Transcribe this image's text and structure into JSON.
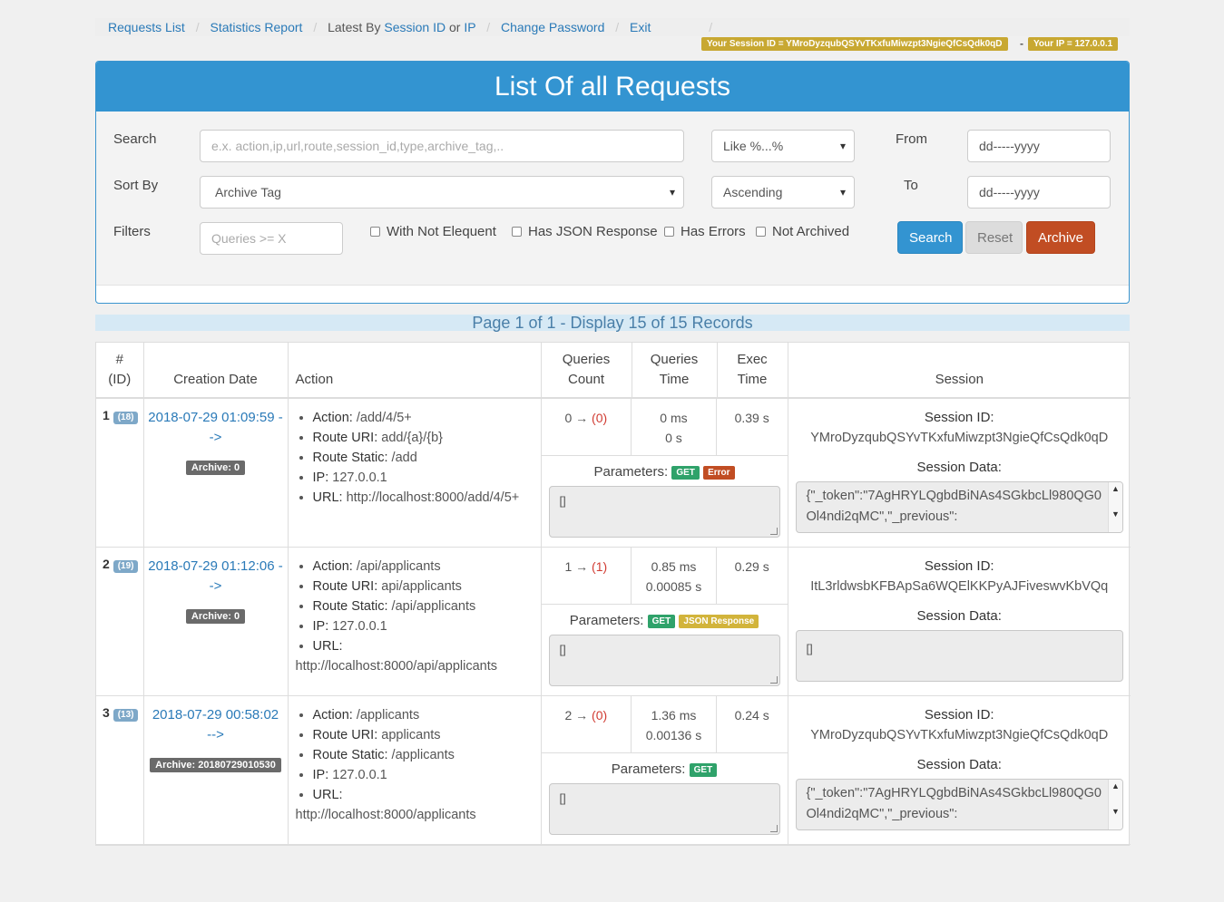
{
  "breadcrumb": {
    "requests_list": "Requests List",
    "statistics_report": "Statistics Report",
    "latest_by": "Latest By",
    "session_id": "Session ID",
    "or": "or",
    "ip": "IP",
    "change_password": "Change Password",
    "exit": "Exit",
    "separator": "/"
  },
  "session_bar": {
    "session_label": "Your Session ID = YMroDyzqubQSYvTKxfuMiwzpt3NgieQfCsQdk0qD",
    "dash": "-",
    "ip_label": "Your IP = 127.0.0.1"
  },
  "panel": {
    "title": "List Of all Requests",
    "search_label": "Search",
    "search_placeholder": "e.x. action,ip,url,route,session_id,type,archive_tag,..",
    "match_mode": "Like %...%",
    "from_label": "From",
    "from_value": "dd-----yyyy",
    "sort_label": "Sort By",
    "sort_value": "Archive Tag",
    "order_value": "Ascending",
    "to_label": "To",
    "to_value": "dd-----yyyy",
    "filters_label": "Filters",
    "queries_placeholder": "Queries >= X",
    "checkboxes": [
      "With Not Elequent",
      "Has JSON Response",
      "Has Errors",
      "Not Archived"
    ],
    "btn_search": "Search",
    "btn_reset": "Reset",
    "btn_archive": "Archive"
  },
  "page_info": "Page 1 of 1 - Display 15 of 15 Records",
  "table": {
    "headers": {
      "id_hash": "#",
      "id": "(ID)",
      "creation_date": "Creation Date",
      "action": "Action",
      "queries_count_1": "Queries",
      "queries_count_2": "Count",
      "queries_time_1": "Queries",
      "queries_time_2": "Time",
      "exec_time_1": "Exec",
      "exec_time_2": "Time",
      "session": "Session"
    },
    "labels": {
      "action": "Action:",
      "route_uri": "Route URI:",
      "route_static": "Route Static:",
      "ip": "IP:",
      "url": "URL:",
      "parameters": "Parameters:",
      "session_id": "Session ID:",
      "session_data": "Session Data:",
      "arrow": "→"
    },
    "rows": [
      {
        "num": "1",
        "id": "(18)",
        "date": "2018-07-29 01:09:59 -",
        "date2": "->",
        "archive": "Archive: 0",
        "action": "/add/4/5+",
        "route_uri": "add/{a}/{b}",
        "route_static": "/add",
        "ip": "127.0.0.1",
        "url": "http://localhost:8000/add/4/5+",
        "q_count": "0",
        "q_count_b": "(0)",
        "q_time": "0 ms",
        "q_time_s": "0 s",
        "exec_time": "0.39 s",
        "tags": [
          "GET",
          "Error"
        ],
        "params": "[]",
        "session_id": "YMroDyzqubQSYvTKxfuMiwzpt3NgieQfCsQdk0qD",
        "session_data": "{\"_token\":\"7AgHRYLQgbdBiNAs4SGkbcLl980QG0Ol4ndi2qMC\",\"_previous\":"
      },
      {
        "num": "2",
        "id": "(19)",
        "date": "2018-07-29 01:12:06 -",
        "date2": "->",
        "archive": "Archive: 0",
        "action": "/api/applicants",
        "route_uri": "api/applicants",
        "route_static": "/api/applicants",
        "ip": "127.0.0.1",
        "url": "http://localhost:8000/api/applicants",
        "q_count": "1",
        "q_count_b": "(1)",
        "q_time": "0.85 ms",
        "q_time_s": "0.00085 s",
        "exec_time": "0.29 s",
        "tags": [
          "GET",
          "JSON Response"
        ],
        "params": "[]",
        "session_id": "ItL3rldwsbKFBApSa6WQElKKPyAJFiveswvKbVQq",
        "session_data": "[]"
      },
      {
        "num": "3",
        "id": "(13)",
        "date": "2018-07-29 00:58:02",
        "date2": "-->",
        "archive": "Archive: 20180729010530",
        "action": "/applicants",
        "route_uri": "applicants",
        "route_static": "/applicants",
        "ip": "127.0.0.1",
        "url": "http://localhost:8000/applicants",
        "q_count": "2",
        "q_count_b": "(0)",
        "q_time": "1.36 ms",
        "q_time_s": "0.00136 s",
        "exec_time": "0.24 s",
        "tags": [
          "GET"
        ],
        "params": "[]",
        "session_id": "YMroDyzqubQSYvTKxfuMiwzpt3NgieQfCsQdk0qD",
        "session_data": "{\"_token\":\"7AgHRYLQgbdBiNAs4SGkbcLl980QG0Ol4ndi2qMC\",\"_previous\":"
      }
    ]
  }
}
